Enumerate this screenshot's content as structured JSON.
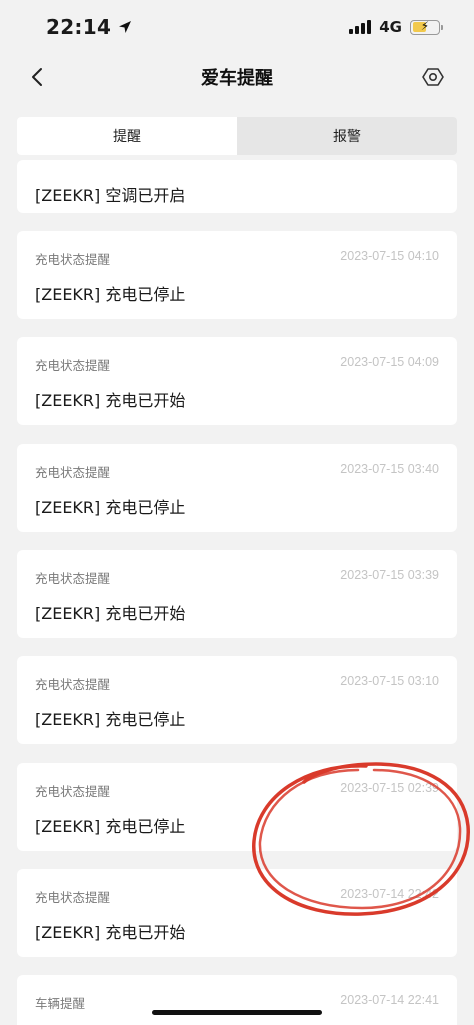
{
  "status_bar": {
    "time": "22:14",
    "network": "4G",
    "battery_level": 0.55,
    "battery_charging": true
  },
  "nav": {
    "title": "爱车提醒",
    "back_icon": "chevron-left-icon",
    "settings_icon": "hexagon-settings-icon"
  },
  "tabs": [
    {
      "label": "提醒",
      "active": true
    },
    {
      "label": "报警",
      "active": false
    }
  ],
  "notifications": [
    {
      "category": "",
      "timestamp": "",
      "message": "[ZEEKR] 空调已开启"
    },
    {
      "category": "充电状态提醒",
      "timestamp": "2023-07-15 04:10",
      "message": "[ZEEKR] 充电已停止"
    },
    {
      "category": "充电状态提醒",
      "timestamp": "2023-07-15 04:09",
      "message": "[ZEEKR] 充电已开始"
    },
    {
      "category": "充电状态提醒",
      "timestamp": "2023-07-15 03:40",
      "message": "[ZEEKR] 充电已停止"
    },
    {
      "category": "充电状态提醒",
      "timestamp": "2023-07-15 03:39",
      "message": "[ZEEKR] 充电已开始"
    },
    {
      "category": "充电状态提醒",
      "timestamp": "2023-07-15 03:10",
      "message": "[ZEEKR] 充电已停止"
    },
    {
      "category": "充电状态提醒",
      "timestamp": "2023-07-15 02:39",
      "message": "[ZEEKR] 充电已停止"
    },
    {
      "category": "充电状态提醒",
      "timestamp": "2023-07-14 22:42",
      "message": "[ZEEKR] 充电已开始"
    },
    {
      "category": "车辆提醒",
      "timestamp": "2023-07-14 22:41",
      "message": ""
    }
  ],
  "colors": {
    "background": "#f2f2f2",
    "card": "#ffffff",
    "annotation": "#d93a2b",
    "battery": "#f2c94c"
  }
}
